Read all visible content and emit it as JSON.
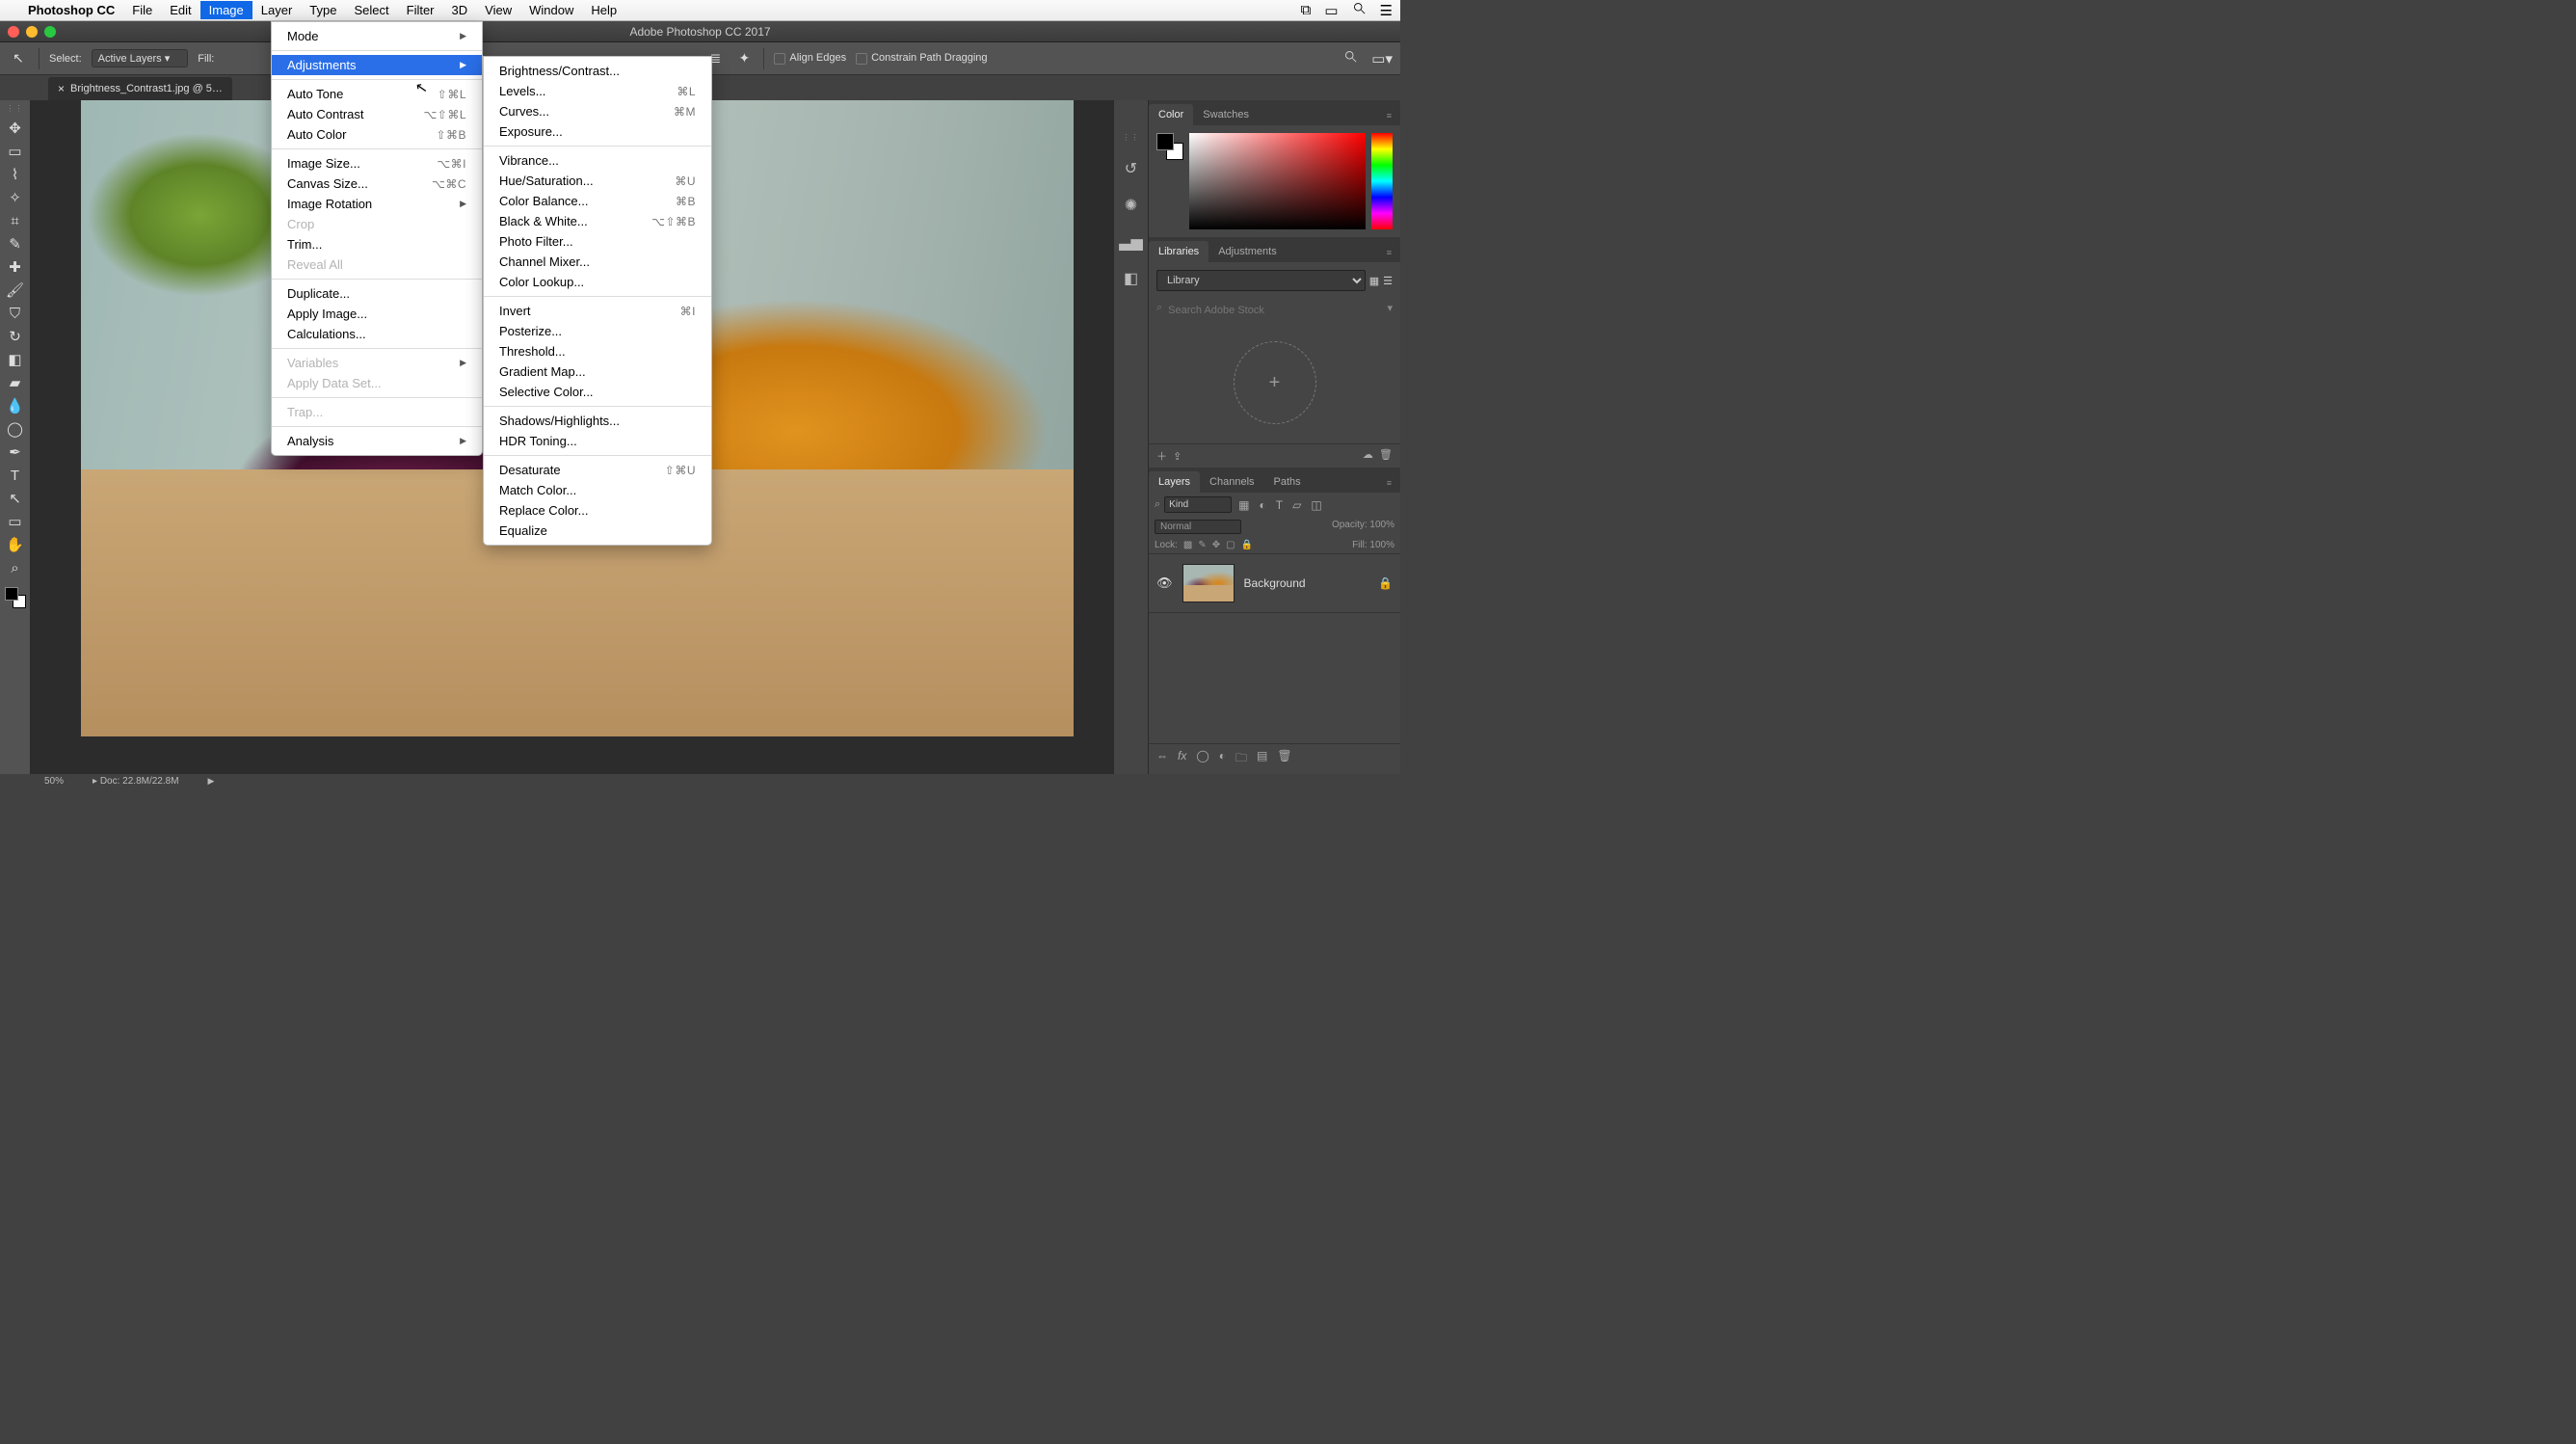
{
  "menubar": {
    "app": "Photoshop CC",
    "items": [
      "File",
      "Edit",
      "Image",
      "Layer",
      "Type",
      "Select",
      "Filter",
      "3D",
      "View",
      "Window",
      "Help"
    ],
    "active_index": 2
  },
  "window": {
    "title": "Adobe Photoshop CC 2017"
  },
  "options": {
    "select_label": "Select:",
    "select_value": "Active Layers",
    "fill_label": "Fill:",
    "align_edges": "Align Edges",
    "constrain": "Constrain Path Dragging"
  },
  "doc_tab": {
    "name": "Brightness_Contrast1.jpg @ 5…"
  },
  "image_menu": [
    {
      "label": "Mode",
      "sub": true
    },
    {
      "sep": true
    },
    {
      "label": "Adjustments",
      "sub": true,
      "highlight": true
    },
    {
      "sep": true
    },
    {
      "label": "Auto Tone",
      "shortcut": "⇧⌘L"
    },
    {
      "label": "Auto Contrast",
      "shortcut": "⌥⇧⌘L"
    },
    {
      "label": "Auto Color",
      "shortcut": "⇧⌘B"
    },
    {
      "sep": true
    },
    {
      "label": "Image Size...",
      "shortcut": "⌥⌘I"
    },
    {
      "label": "Canvas Size...",
      "shortcut": "⌥⌘C"
    },
    {
      "label": "Image Rotation",
      "sub": true
    },
    {
      "label": "Crop",
      "disabled": true
    },
    {
      "label": "Trim..."
    },
    {
      "label": "Reveal All",
      "disabled": true
    },
    {
      "sep": true
    },
    {
      "label": "Duplicate..."
    },
    {
      "label": "Apply Image..."
    },
    {
      "label": "Calculations..."
    },
    {
      "sep": true
    },
    {
      "label": "Variables",
      "sub": true,
      "disabled": true
    },
    {
      "label": "Apply Data Set...",
      "disabled": true
    },
    {
      "sep": true
    },
    {
      "label": "Trap...",
      "disabled": true
    },
    {
      "sep": true
    },
    {
      "label": "Analysis",
      "sub": true
    }
  ],
  "adjustments_menu": [
    {
      "label": "Brightness/Contrast..."
    },
    {
      "label": "Levels...",
      "shortcut": "⌘L"
    },
    {
      "label": "Curves...",
      "shortcut": "⌘M"
    },
    {
      "label": "Exposure..."
    },
    {
      "sep": true
    },
    {
      "label": "Vibrance..."
    },
    {
      "label": "Hue/Saturation...",
      "shortcut": "⌘U"
    },
    {
      "label": "Color Balance...",
      "shortcut": "⌘B"
    },
    {
      "label": "Black & White...",
      "shortcut": "⌥⇧⌘B"
    },
    {
      "label": "Photo Filter..."
    },
    {
      "label": "Channel Mixer..."
    },
    {
      "label": "Color Lookup..."
    },
    {
      "sep": true
    },
    {
      "label": "Invert",
      "shortcut": "⌘I"
    },
    {
      "label": "Posterize..."
    },
    {
      "label": "Threshold..."
    },
    {
      "label": "Gradient Map..."
    },
    {
      "label": "Selective Color..."
    },
    {
      "sep": true
    },
    {
      "label": "Shadows/Highlights..."
    },
    {
      "label": "HDR Toning..."
    },
    {
      "sep": true
    },
    {
      "label": "Desaturate",
      "shortcut": "⇧⌘U"
    },
    {
      "label": "Match Color..."
    },
    {
      "label": "Replace Color..."
    },
    {
      "label": "Equalize"
    }
  ],
  "panels": {
    "color_tab": "Color",
    "swatches_tab": "Swatches",
    "libraries_tab": "Libraries",
    "adjustments_tab": "Adjustments",
    "library_select": "Library",
    "library_search_placeholder": "Search Adobe Stock",
    "plus": "+",
    "layers_tab": "Layers",
    "channels_tab": "Channels",
    "paths_tab": "Paths",
    "kind_label": "Kind",
    "blend_mode": "Normal",
    "opacity_label": "Opacity:",
    "opacity_value": "100%",
    "lock_label": "Lock:",
    "fill_label": "Fill:",
    "fill_value": "100%",
    "layer_name": "Background"
  },
  "status": {
    "zoom": "50%",
    "doc": "Doc: 22.8M/22.8M"
  },
  "left_tools": [
    "move",
    "marquee",
    "lasso",
    "wand",
    "crop",
    "eyedropper",
    "heal",
    "brush",
    "stamp",
    "history",
    "eraser",
    "gradient",
    "blur",
    "dodge",
    "pen",
    "type",
    "path",
    "shape",
    "hand",
    "zoom"
  ]
}
